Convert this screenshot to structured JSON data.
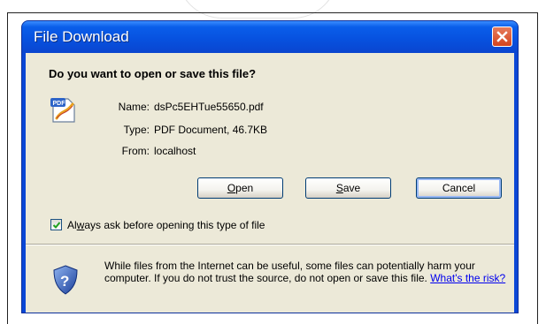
{
  "window": {
    "title": "File Download",
    "question": "Do you want to open or save this file?"
  },
  "file": {
    "name_label": "Name:",
    "name_value": "dsPc5EHTue55650.pdf",
    "type_label": "Type:",
    "type_value": "PDF Document, 46.7KB",
    "from_label": "From:",
    "from_value": "localhost",
    "icon": "pdf-file-icon"
  },
  "buttons": {
    "open_first": "O",
    "open_rest": "pen",
    "save_first": "S",
    "save_rest": "ave",
    "cancel": "Cancel"
  },
  "checkbox": {
    "checked": true,
    "label_a": "Al",
    "label_w": "w",
    "label_rest": "ays ask before opening this type of file"
  },
  "warning": {
    "text": "While files from the Internet can be useful, some files can potentially harm your computer. If you do not trust the source, do not open or save this file. ",
    "link": "What's the risk?",
    "icon": "security-shield-question-icon"
  },
  "colors": {
    "titlebar": "#0752e0",
    "client_bg": "#ece9d8",
    "close_button": "#d4441e",
    "link": "#0000ee"
  }
}
